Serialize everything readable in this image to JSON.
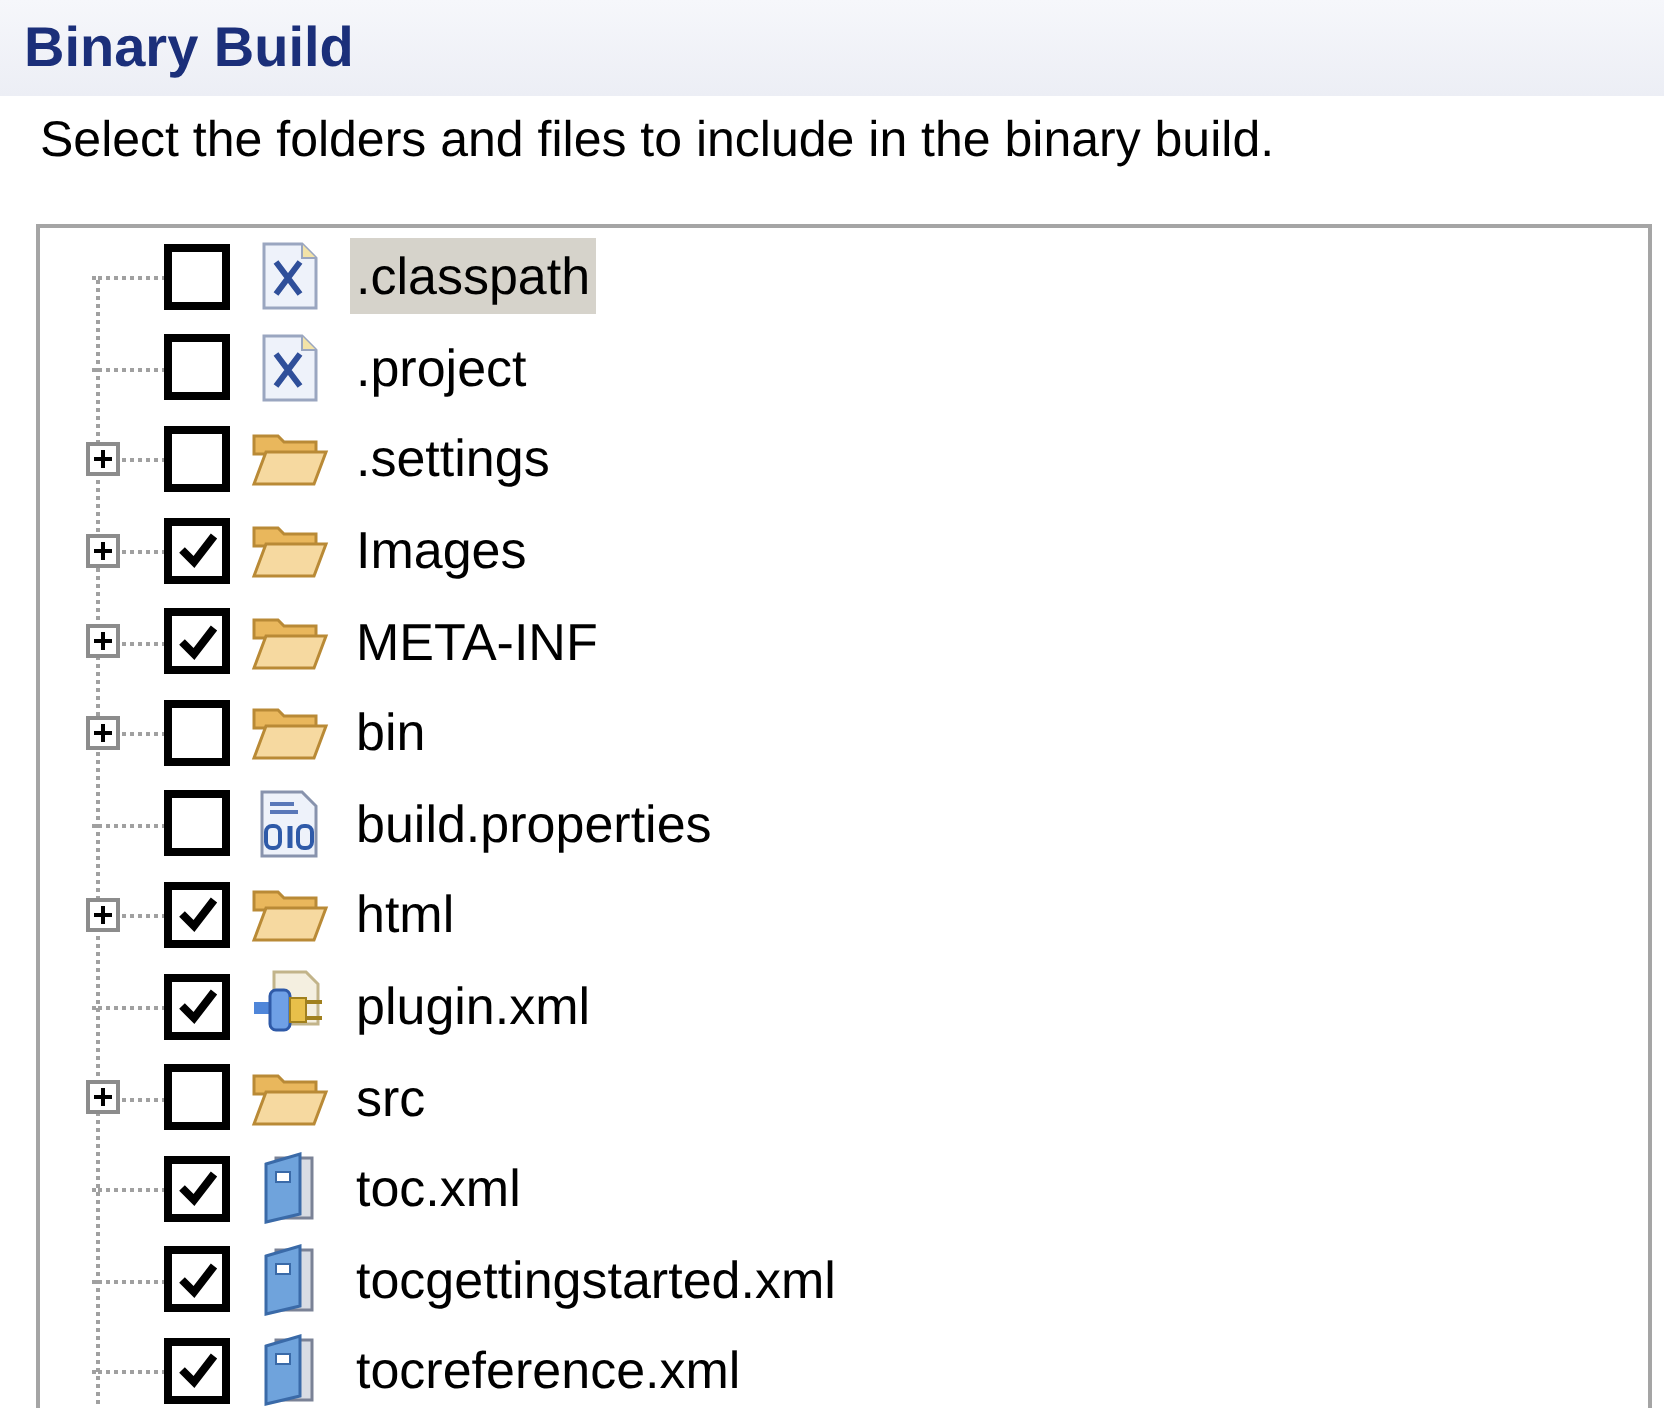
{
  "section": {
    "title": "Binary Build",
    "description": "Select the folders and files to include in the binary build."
  },
  "tree": [
    {
      "label": ".classpath",
      "kind": "xfile",
      "checked": false,
      "selected": true
    },
    {
      "label": ".project",
      "kind": "xfile",
      "checked": false,
      "selected": false
    },
    {
      "label": ".settings",
      "kind": "folder",
      "checked": false,
      "selected": false,
      "expanded": false
    },
    {
      "label": "Images",
      "kind": "folder",
      "checked": true,
      "selected": false,
      "expanded": false
    },
    {
      "label": "META-INF",
      "kind": "folder",
      "checked": true,
      "selected": false,
      "expanded": false
    },
    {
      "label": "bin",
      "kind": "folder",
      "checked": false,
      "selected": false,
      "expanded": false
    },
    {
      "label": "build.properties",
      "kind": "properties",
      "checked": false,
      "selected": false
    },
    {
      "label": "html",
      "kind": "folder",
      "checked": true,
      "selected": false,
      "expanded": false
    },
    {
      "label": "plugin.xml",
      "kind": "plugin",
      "checked": true,
      "selected": false
    },
    {
      "label": "src",
      "kind": "folder",
      "checked": false,
      "selected": false,
      "expanded": false
    },
    {
      "label": "toc.xml",
      "kind": "toc",
      "checked": true,
      "selected": false
    },
    {
      "label": "tocgettingstarted.xml",
      "kind": "toc",
      "checked": true,
      "selected": false
    },
    {
      "label": "tocreference.xml",
      "kind": "toc",
      "checked": true,
      "selected": false
    }
  ]
}
